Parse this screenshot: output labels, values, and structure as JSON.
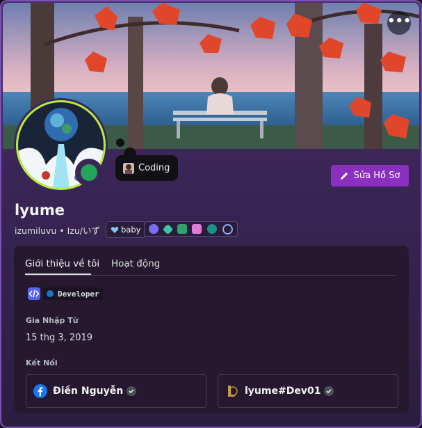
{
  "activity": {
    "label": "Coding"
  },
  "edit_button": {
    "label": "Sửa Hồ Sơ"
  },
  "more_button": {
    "label": "•••"
  },
  "profile": {
    "display_name": "lyume",
    "username_line": "izumiluvu • Izu/いず",
    "tag": "baby"
  },
  "tabs": [
    {
      "label": "Giới thiệu về tôi",
      "active": true
    },
    {
      "label": "Hoạt động",
      "active": false
    }
  ],
  "about": {
    "dev_chip": "Developer"
  },
  "member_since": {
    "label": "Gia Nhập Từ",
    "value": "15 thg 3, 2019"
  },
  "connections": {
    "label": "Kết Nối",
    "items": [
      {
        "name": "Điền Nguyễn",
        "icon": "facebook-icon"
      },
      {
        "name": "lyume#Dev01",
        "icon": "league-of-legends-icon"
      }
    ]
  },
  "colors": {
    "status_online": "#23a55a",
    "edit_button": "#8b2fbf",
    "avatar_ring": "#b6ef3b"
  }
}
